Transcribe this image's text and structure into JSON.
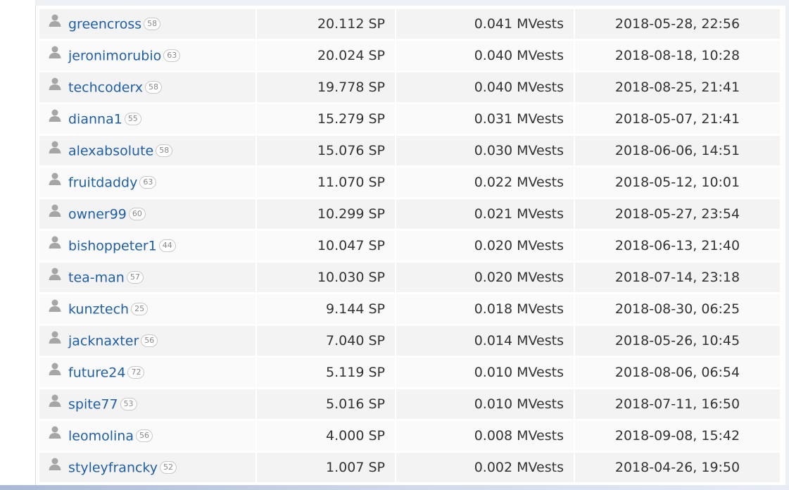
{
  "rows": [
    {
      "name": "greencross",
      "rep": "58",
      "sp": "20.112 SP",
      "vests": "0.041 MVests",
      "date": "2018-05-28, 22:56"
    },
    {
      "name": "jeronimorubio",
      "rep": "63",
      "sp": "20.024 SP",
      "vests": "0.040 MVests",
      "date": "2018-08-18, 10:28"
    },
    {
      "name": "techcoderx",
      "rep": "58",
      "sp": "19.778 SP",
      "vests": "0.040 MVests",
      "date": "2018-08-25, 21:41"
    },
    {
      "name": "dianna1",
      "rep": "55",
      "sp": "15.279 SP",
      "vests": "0.031 MVests",
      "date": "2018-05-07, 21:41"
    },
    {
      "name": "alexabsolute",
      "rep": "58",
      "sp": "15.076 SP",
      "vests": "0.030 MVests",
      "date": "2018-06-06, 14:51"
    },
    {
      "name": "fruitdaddy",
      "rep": "63",
      "sp": "11.070 SP",
      "vests": "0.022 MVests",
      "date": "2018-05-12, 10:01"
    },
    {
      "name": "owner99",
      "rep": "60",
      "sp": "10.299 SP",
      "vests": "0.021 MVests",
      "date": "2018-05-27, 23:54"
    },
    {
      "name": "bishoppeter1",
      "rep": "44",
      "sp": "10.047 SP",
      "vests": "0.020 MVests",
      "date": "2018-06-13, 21:40"
    },
    {
      "name": "tea-man",
      "rep": "57",
      "sp": "10.030 SP",
      "vests": "0.020 MVests",
      "date": "2018-07-14, 23:18"
    },
    {
      "name": "kunztech",
      "rep": "25",
      "sp": "9.144 SP",
      "vests": "0.018 MVests",
      "date": "2018-08-30, 06:25"
    },
    {
      "name": "jacknaxter",
      "rep": "56",
      "sp": "7.040 SP",
      "vests": "0.014 MVests",
      "date": "2018-05-26, 10:45"
    },
    {
      "name": "future24",
      "rep": "72",
      "sp": "5.119 SP",
      "vests": "0.010 MVests",
      "date": "2018-08-06, 06:54"
    },
    {
      "name": "spite77",
      "rep": "53",
      "sp": "5.016 SP",
      "vests": "0.010 MVests",
      "date": "2018-07-11, 16:50"
    },
    {
      "name": "leomolina",
      "rep": "56",
      "sp": "4.000 SP",
      "vests": "0.008 MVests",
      "date": "2018-09-08, 15:42"
    },
    {
      "name": "styleyfrancky",
      "rep": "52",
      "sp": "1.007 SP",
      "vests": "0.002 MVests",
      "date": "2018-04-26, 19:50"
    }
  ],
  "colors": {
    "link": "#1f5fa8",
    "row_odd": "#f3f3f3",
    "row_even": "#fafafa",
    "icon": "#a6a6a6"
  },
  "icons": {
    "user": "user-icon"
  }
}
